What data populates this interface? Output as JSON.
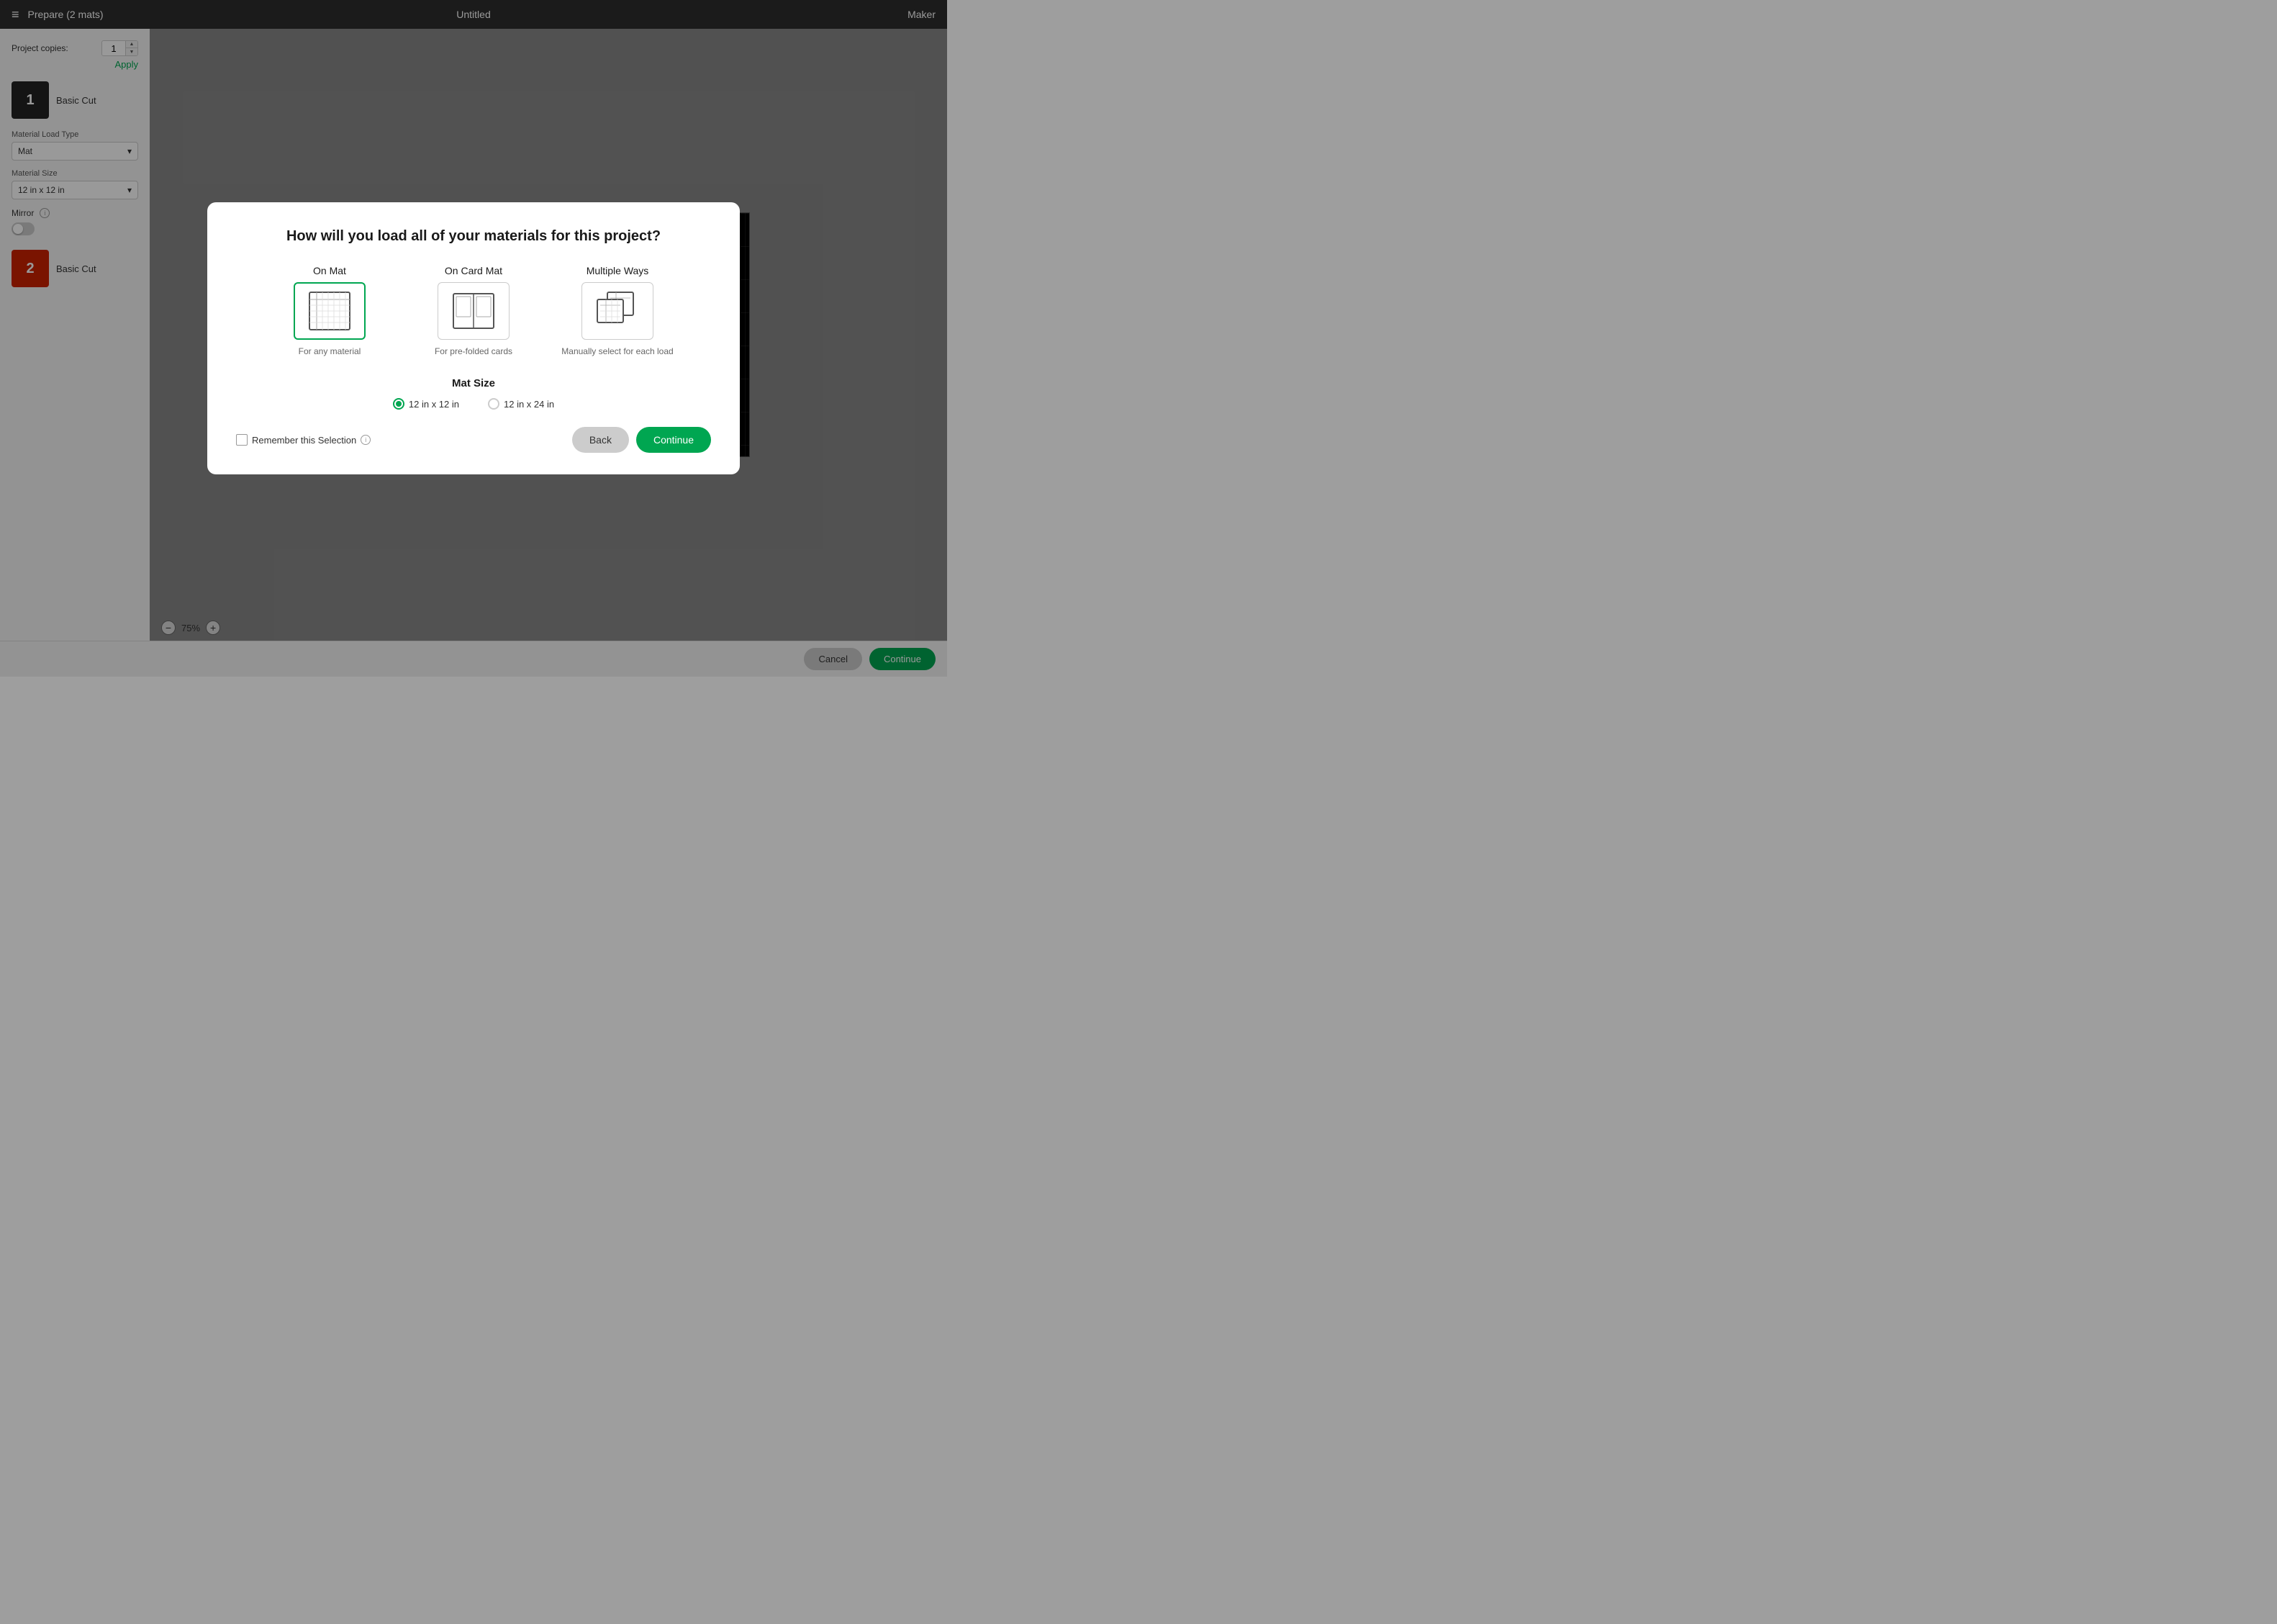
{
  "topBar": {
    "menuIcon": "≡",
    "title": "Prepare (2 mats)",
    "centerTitle": "Untitled",
    "rightLabel": "Maker"
  },
  "leftPanel": {
    "projectCopiesLabel": "Project copies:",
    "copiesValue": "1",
    "applyLabel": "Apply",
    "mats": [
      {
        "number": "1",
        "color": "black",
        "label": "Basic Cut"
      },
      {
        "number": "2",
        "color": "red",
        "label": "Basic Cut"
      }
    ],
    "materialLoadTypeLabel": "Material Load Type",
    "materialLoadTypeValue": "Mat",
    "materialSizeLabel": "Material Size",
    "materialSizeValue": "12 in x 12 in",
    "mirrorLabel": "Mirror",
    "infoIcon": "i"
  },
  "zoom": {
    "level": "75%",
    "decreaseIcon": "−",
    "increaseIcon": "+"
  },
  "bottomBar": {
    "cancelLabel": "Cancel",
    "continueLabel": "Continue"
  },
  "modal": {
    "title": "How will you load all of your materials for this project?",
    "options": [
      {
        "id": "on-mat",
        "label": "On Mat",
        "description": "For any material",
        "selected": true
      },
      {
        "id": "on-card-mat",
        "label": "On Card Mat",
        "description": "For pre-folded cards",
        "selected": false
      },
      {
        "id": "multiple-ways",
        "label": "Multiple Ways",
        "description": "Manually select for each load",
        "selected": false
      }
    ],
    "matSizeTitle": "Mat Size",
    "matSizes": [
      {
        "label": "12 in x 12 in",
        "selected": true
      },
      {
        "label": "12 in x 24 in",
        "selected": false
      }
    ],
    "rememberLabel": "Remember this Selection",
    "infoIcon": "i",
    "backLabel": "Back",
    "continueLabel": "Continue"
  }
}
